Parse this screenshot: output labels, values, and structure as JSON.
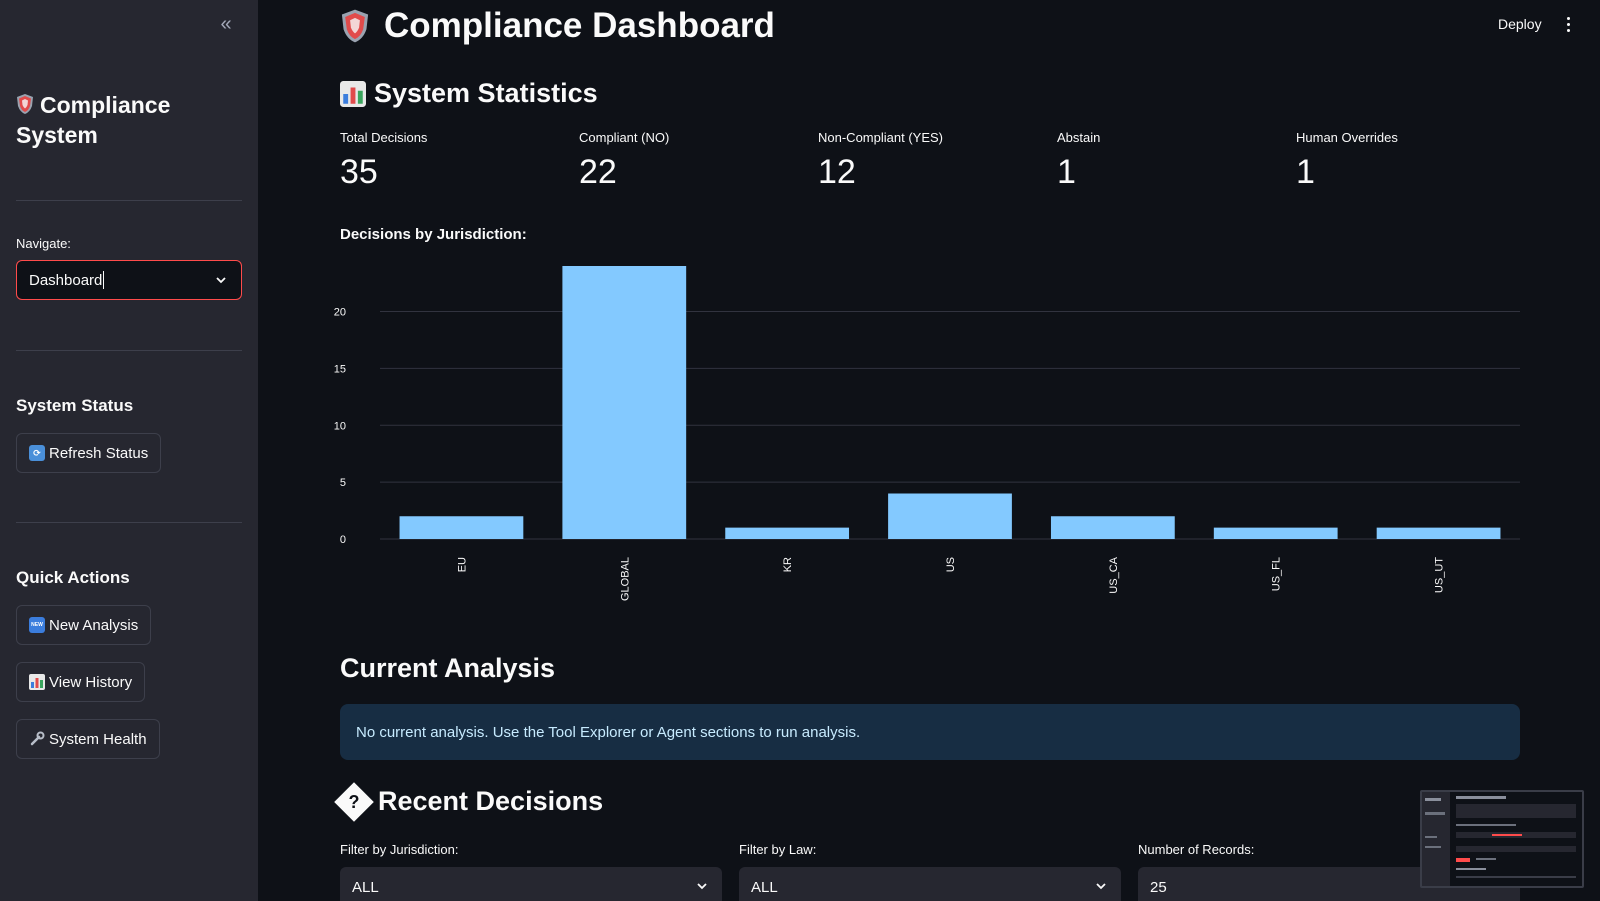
{
  "sidebar": {
    "title": "Compliance System",
    "navigate_label": "Navigate:",
    "navigate_value": "Dashboard",
    "system_status_heading": "System Status",
    "refresh_button": "Refresh Status",
    "quick_actions_heading": "Quick Actions",
    "new_analysis_button": "New Analysis",
    "view_history_button": "View History",
    "system_health_button": "System Health",
    "new_badge": "NEW"
  },
  "header": {
    "deploy_label": "Deploy"
  },
  "main": {
    "title": "Compliance Dashboard",
    "stats_heading": "System Statistics",
    "metrics": [
      {
        "label": "Total Decisions",
        "value": "35"
      },
      {
        "label": "Compliant (NO)",
        "value": "22"
      },
      {
        "label": "Non-Compliant (YES)",
        "value": "12"
      },
      {
        "label": "Abstain",
        "value": "1"
      },
      {
        "label": "Human Overrides",
        "value": "1"
      }
    ],
    "chart_label": "Decisions by Jurisdiction:",
    "current_analysis_heading": "Current Analysis",
    "info_message": "No current analysis. Use the Tool Explorer or Agent sections to run analysis.",
    "recent_decisions_heading": "Recent Decisions",
    "recent_decisions_icon_glyph": "?",
    "filters": [
      {
        "label": "Filter by Jurisdiction:",
        "value": "ALL"
      },
      {
        "label": "Filter by Law:",
        "value": "ALL"
      },
      {
        "label": "Number of Records:",
        "value": "25"
      }
    ]
  },
  "colors": {
    "accent": "#ff4b4b",
    "bar": "#83c9ff",
    "info_bg": "#172d43",
    "sidebar_bg": "#262730",
    "app_bg": "#0e1117"
  },
  "chart_data": {
    "type": "bar",
    "categories": [
      "EU",
      "GLOBAL",
      "KR",
      "US",
      "US_CA",
      "US_FL",
      "US_UT"
    ],
    "values": [
      2,
      24,
      1,
      4,
      2,
      1,
      1
    ],
    "yticks": [
      0,
      5,
      10,
      15,
      20
    ],
    "ylim": [
      0,
      24
    ],
    "grid": true
  }
}
